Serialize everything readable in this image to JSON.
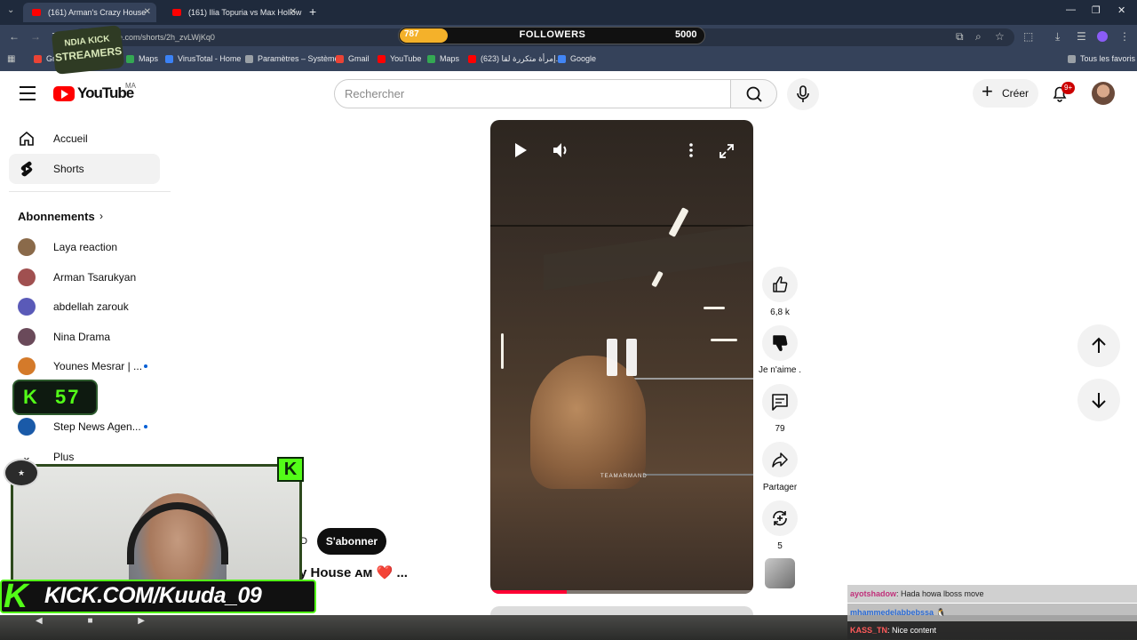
{
  "browser": {
    "tabs": [
      {
        "title": "(161) Arman's Crazy House"
      },
      {
        "title": "(161) Ilia Topuria vs Max Hollow"
      }
    ],
    "url": "be.com/shorts/2h_zvLWjKq0",
    "bookmarks": [
      {
        "label": "Gm",
        "color": "#ea4335"
      },
      {
        "label": "Maps",
        "color": "#34a853"
      },
      {
        "label": "VirusTotal - Home",
        "color": "#3b82f6"
      },
      {
        "label": "Paramètres – Système",
        "color": "#9aa0a6"
      },
      {
        "label": "Gmail",
        "color": "#ea4335"
      },
      {
        "label": "YouTube",
        "color": "#ff0000"
      },
      {
        "label": "Maps",
        "color": "#34a853"
      },
      {
        "label": "(623) إمرأة متكررة لقا...",
        "color": "#ff0000"
      },
      {
        "label": "Google",
        "color": "#4285f4"
      }
    ],
    "all_bookmarks": "Tous les favoris"
  },
  "followers_goal": {
    "current": 787,
    "label": "FOLLOWERS",
    "goal": 5000,
    "fill_color": "#f4b12a"
  },
  "stream_logo": {
    "line1": "NDIA KICK",
    "line2": "STREAMERS"
  },
  "youtube": {
    "logo_text": "YouTube",
    "country": "MA",
    "search_placeholder": "Rechercher",
    "create_label": "Créer",
    "notif_badge": "9+",
    "sidebar": {
      "items": [
        {
          "label": "Accueil",
          "icon": "home-icon"
        },
        {
          "label": "Shorts",
          "icon": "shorts-icon"
        }
      ],
      "subscriptions_title": "Abonnements",
      "subscriptions": [
        {
          "name": "Laya reaction",
          "color": "#8a6a4a",
          "new": false
        },
        {
          "name": "Arman Tsarukyan",
          "color": "#a05050",
          "new": false
        },
        {
          "name": "abdellah zarouk",
          "color": "#5a5ab8",
          "new": false
        },
        {
          "name": "Nina Drama",
          "color": "#6a4a5a",
          "new": false
        },
        {
          "name": "Younes Mesrar | ...",
          "color": "#d47a2a",
          "new": true
        },
        {
          "name": "Step News Agen...",
          "color": "#1a5aa8",
          "new": true
        }
      ],
      "more_label": "Plus"
    },
    "short": {
      "channel_tail": "nD",
      "subscribe_label": "S'abonner",
      "title": "y House ᴀᴍ ❤️ ...",
      "watermark": "TEAMARMAND",
      "progress": 0.29,
      "actions": {
        "likes": "6,8 k",
        "dislike_label": "Je n'aime .",
        "comments": "79",
        "share_label": "Partager",
        "remix_count": "5"
      }
    }
  },
  "kick": {
    "counter_value": "57",
    "banner": "KICK.COM/Kuuda_09",
    "accent": "#53fc18"
  },
  "chat": [
    {
      "user": "ayotshadow",
      "text": ": Hada howa lboss move",
      "user_color": "#ff9ad5"
    },
    {
      "user": "mhammedelabbebssa",
      "text": " 🐧",
      "user_color": "#6fa8ff"
    },
    {
      "user": "KASS_TN",
      "text": ": Nice content",
      "user_color": "#ff5a5a"
    }
  ]
}
